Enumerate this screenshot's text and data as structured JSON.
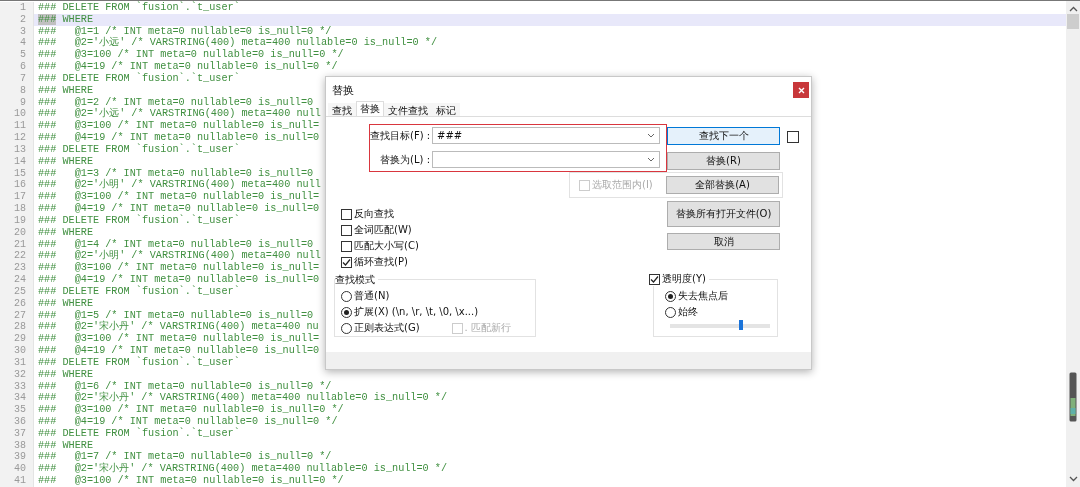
{
  "editor": {
    "lines": [
      {
        "number": "1",
        "text": "### DELETE FROM `fusion`.`t_user`",
        "selected": false
      },
      {
        "number": "2",
        "text": "### WHERE",
        "selected": true
      },
      {
        "number": "3",
        "text": "###   @1=1 /* INT meta=0 nullable=0 is_null=0 */",
        "selected": false
      },
      {
        "number": "4",
        "text": "###   @2='小远' /* VARSTRING(400) meta=400 nullable=0 is_null=0 */",
        "selected": false
      },
      {
        "number": "5",
        "text": "###   @3=100 /* INT meta=0 nullable=0 is_null=0 */",
        "selected": false
      },
      {
        "number": "6",
        "text": "###   @4=19 /* INT meta=0 nullable=0 is_null=0 */",
        "selected": false
      },
      {
        "number": "7",
        "text": "### DELETE FROM `fusion`.`t_user`",
        "selected": false
      },
      {
        "number": "8",
        "text": "### WHERE",
        "selected": false
      },
      {
        "number": "9",
        "text": "###   @1=2 /* INT meta=0 nullable=0 is_null=0",
        "selected": false
      },
      {
        "number": "10",
        "text": "###   @2='小远' /* VARSTRING(400) meta=400 null",
        "selected": false
      },
      {
        "number": "11",
        "text": "###   @3=100 /* INT meta=0 nullable=0 is_null=",
        "selected": false
      },
      {
        "number": "12",
        "text": "###   @4=19 /* INT meta=0 nullable=0 is_null=0",
        "selected": false
      },
      {
        "number": "13",
        "text": "### DELETE FROM `fusion`.`t_user`",
        "selected": false
      },
      {
        "number": "14",
        "text": "### WHERE",
        "selected": false
      },
      {
        "number": "15",
        "text": "###   @1=3 /* INT meta=0 nullable=0 is_null=0",
        "selected": false
      },
      {
        "number": "16",
        "text": "###   @2='小明' /* VARSTRING(400) meta=400 null",
        "selected": false
      },
      {
        "number": "17",
        "text": "###   @3=100 /* INT meta=0 nullable=0 is_null=",
        "selected": false
      },
      {
        "number": "18",
        "text": "###   @4=19 /* INT meta=0 nullable=0 is_null=0",
        "selected": false
      },
      {
        "number": "19",
        "text": "### DELETE FROM `fusion`.`t_user`",
        "selected": false
      },
      {
        "number": "20",
        "text": "### WHERE",
        "selected": false
      },
      {
        "number": "21",
        "text": "###   @1=4 /* INT meta=0 nullable=0 is_null=0",
        "selected": false
      },
      {
        "number": "22",
        "text": "###   @2='小明' /* VARSTRING(400) meta=400 null",
        "selected": false
      },
      {
        "number": "23",
        "text": "###   @3=100 /* INT meta=0 nullable=0 is_null=",
        "selected": false
      },
      {
        "number": "24",
        "text": "###   @4=19 /* INT meta=0 nullable=0 is_null=0",
        "selected": false
      },
      {
        "number": "25",
        "text": "### DELETE FROM `fusion`.`t_user`",
        "selected": false
      },
      {
        "number": "26",
        "text": "### WHERE",
        "selected": false
      },
      {
        "number": "27",
        "text": "###   @1=5 /* INT meta=0 nullable=0 is_null=0",
        "selected": false
      },
      {
        "number": "28",
        "text": "###   @2='宋小丹' /* VARSTRING(400) meta=400 nu",
        "selected": false
      },
      {
        "number": "29",
        "text": "###   @3=100 /* INT meta=0 nullable=0 is_null=",
        "selected": false
      },
      {
        "number": "30",
        "text": "###   @4=19 /* INT meta=0 nullable=0 is_null=0",
        "selected": false
      },
      {
        "number": "31",
        "text": "### DELETE FROM `fusion`.`t_user`",
        "selected": false
      },
      {
        "number": "32",
        "text": "### WHERE",
        "selected": false
      },
      {
        "number": "33",
        "text": "###   @1=6 /* INT meta=0 nullable=0 is_null=0 */",
        "selected": false
      },
      {
        "number": "34",
        "text": "###   @2='宋小丹' /* VARSTRING(400) meta=400 nullable=0 is_null=0 */",
        "selected": false
      },
      {
        "number": "35",
        "text": "###   @3=100 /* INT meta=0 nullable=0 is_null=0 */",
        "selected": false
      },
      {
        "number": "36",
        "text": "###   @4=19 /* INT meta=0 nullable=0 is_null=0 */",
        "selected": false
      },
      {
        "number": "37",
        "text": "### DELETE FROM `fusion`.`t_user`",
        "selected": false
      },
      {
        "number": "38",
        "text": "### WHERE",
        "selected": false
      },
      {
        "number": "39",
        "text": "###   @1=7 /* INT meta=0 nullable=0 is_null=0 */",
        "selected": false
      },
      {
        "number": "40",
        "text": "###   @2='宋小丹' /* VARSTRING(400) meta=400 nullable=0 is_null=0 */",
        "selected": false
      },
      {
        "number": "41",
        "text": "###   @3=100 /* INT meta=0 nullable=0 is_null=0 */",
        "selected": false
      }
    ]
  },
  "dialog": {
    "title": "替换",
    "tabs": [
      {
        "label": "查找",
        "selected": false
      },
      {
        "label": "替换",
        "selected": true
      },
      {
        "label": "文件查找",
        "selected": false
      },
      {
        "label": "标记",
        "selected": false
      }
    ],
    "find": {
      "label": "查找目标(F) :",
      "value": "###"
    },
    "replace": {
      "label": "替换为(L) :"
    },
    "buttons": [
      {
        "label": "查找下一个",
        "focused": true
      },
      {
        "label": "替换(R)",
        "focused": false
      },
      {
        "label": "全部替换(A)",
        "focused": false
      },
      {
        "label": "替换所有打开文件(O)",
        "focused": false
      },
      {
        "label": "取消",
        "focused": false
      }
    ],
    "side_checkbox": {
      "checked": false
    },
    "in_selection": {
      "label": "选取范围内(I)",
      "checked": false,
      "disabled": true
    },
    "options": [
      {
        "label": "反向查找",
        "checked": false
      },
      {
        "label": "全词匹配(W)",
        "checked": false
      },
      {
        "label": "匹配大小写(C)",
        "checked": false
      },
      {
        "label": "循环查找(P)",
        "checked": true
      }
    ],
    "search_mode": {
      "title": "查找模式",
      "options": [
        {
          "label": "普通(N)",
          "selected": false
        },
        {
          "label": "扩展(X) (\\n, \\r, \\t, \\0, \\x...)",
          "selected": true
        },
        {
          "label": "正则表达式(G)",
          "selected": false
        }
      ],
      "match_newline": {
        "label": ". 匹配新行",
        "checked": false,
        "disabled": true
      }
    },
    "transparency": {
      "label": "透明度(Y)",
      "checked": true,
      "options": [
        {
          "label": "失去焦点后",
          "selected": true
        },
        {
          "label": "始终",
          "selected": false
        }
      ],
      "level": 0.71
    }
  }
}
